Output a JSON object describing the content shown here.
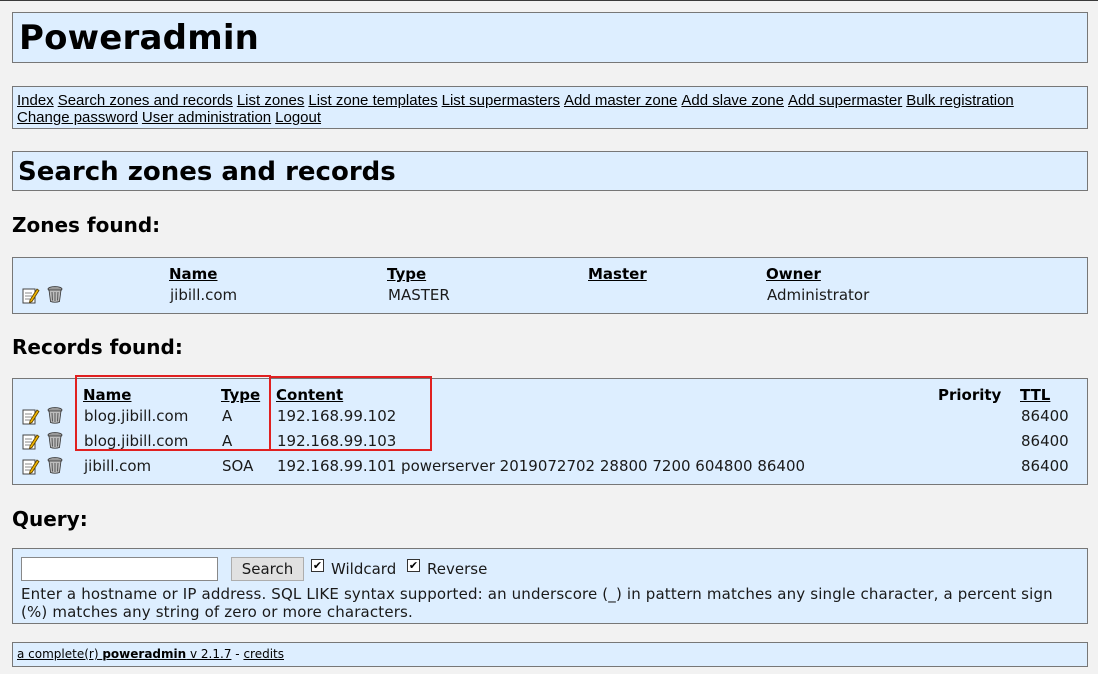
{
  "app": {
    "title": "Poweradmin"
  },
  "menu": {
    "row1": [
      "Index",
      "Search zones and records",
      "List zones",
      "List zone templates",
      "List supermasters",
      "Add master zone",
      "Add slave zone",
      "Add supermaster",
      "Bulk registration"
    ],
    "row2": [
      "Change password",
      "User administration",
      "Logout"
    ]
  },
  "page": {
    "title": "Search zones and records"
  },
  "zones": {
    "heading": "Zones found:",
    "headers": {
      "name": "Name",
      "type": "Type",
      "master": "Master",
      "owner": "Owner"
    },
    "rows": [
      {
        "name": "jibill.com",
        "type": "MASTER",
        "master": "",
        "owner": "Administrator"
      }
    ]
  },
  "records": {
    "heading": "Records found:",
    "headers": {
      "name": "Name",
      "type": "Type",
      "content": "Content",
      "priority": "Priority",
      "ttl": "TTL"
    },
    "rows": [
      {
        "name": "blog.jibill.com",
        "type": "A",
        "content": "192.168.99.102",
        "priority": "",
        "ttl": "86400"
      },
      {
        "name": "blog.jibill.com",
        "type": "A",
        "content": "192.168.99.103",
        "priority": "",
        "ttl": "86400"
      },
      {
        "name": "jibill.com",
        "type": "SOA",
        "content": "192.168.99.101 powerserver 2019072702 28800 7200 604800 86400",
        "priority": "",
        "ttl": "86400"
      }
    ]
  },
  "query": {
    "heading": "Query:",
    "input_value": "",
    "search_label": "Search",
    "wildcard_label": "Wildcard",
    "wildcard_checked": true,
    "reverse_label": "Reverse",
    "reverse_checked": true,
    "help_text": "Enter a hostname or IP address. SQL LIKE syntax supported: an underscore (_) in pattern matches any single character, a percent sign (%) matches any string of zero or more characters."
  },
  "footer": {
    "prefix": "a complete(r)",
    "app_name": "poweradmin",
    "version": "v 2.1.7",
    "separator": "-",
    "credits": "credits"
  },
  "colors": {
    "panel": "#ddeeff",
    "highlight": "#e02020"
  },
  "icons": {
    "edit": "edit-icon",
    "delete": "trash-icon"
  }
}
